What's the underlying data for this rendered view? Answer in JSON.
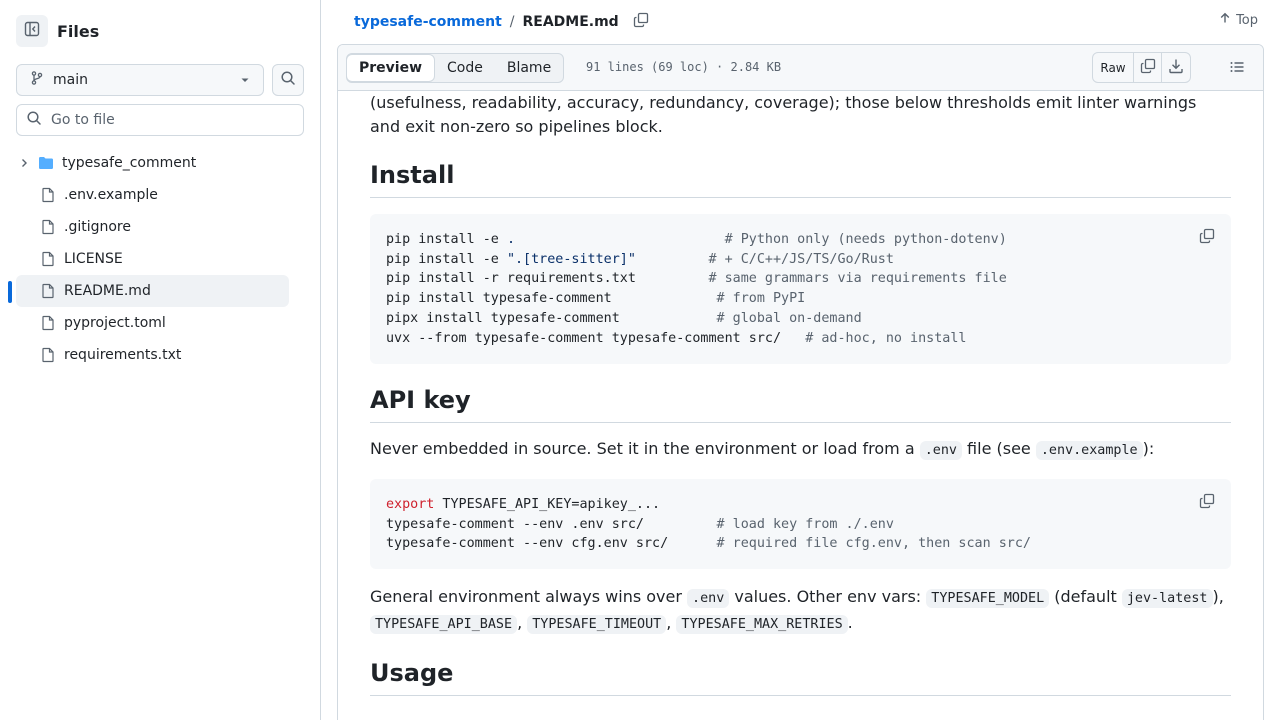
{
  "sidebar": {
    "title": "Files",
    "branch": "main",
    "goto_placeholder": "Go to file",
    "items": [
      {
        "label": "typesafe_comment",
        "type": "folder"
      },
      {
        "label": ".env.example",
        "type": "file"
      },
      {
        "label": ".gitignore",
        "type": "file"
      },
      {
        "label": "LICENSE",
        "type": "file"
      },
      {
        "label": "README.md",
        "type": "file",
        "active": true
      },
      {
        "label": "pyproject.toml",
        "type": "file"
      },
      {
        "label": "requirements.txt",
        "type": "file"
      }
    ]
  },
  "header": {
    "repo": "typesafe-comment",
    "separator": "/",
    "file": "README.md",
    "top_label": "Top"
  },
  "fileview": {
    "tabs": [
      "Preview",
      "Code",
      "Blame"
    ],
    "active_tab": "Preview",
    "meta": "91 lines (69 loc) · 2.84 KB",
    "raw_label": "Raw"
  },
  "readme": {
    "intro": "(usefulness, readability, accuracy, redundancy, coverage); those below thresholds emit linter warnings and exit non-zero so pipelines block.",
    "install_heading": "Install",
    "install_lines": [
      {
        "cmd": "pip install -e ",
        "arg": ".",
        "pad": "                          ",
        "comment": "# Python only (needs python-dotenv)"
      },
      {
        "cmd": "pip install -e ",
        "arg": "\".[tree-sitter]\"",
        "pad": "         ",
        "comment": "# + C/C++/JS/TS/Go/Rust"
      },
      {
        "cmd": "pip install -r requirements.txt",
        "arg": "",
        "pad": "         ",
        "comment": "# same grammars via requirements file"
      },
      {
        "cmd": "pip install typesafe-comment",
        "arg": "",
        "pad": "             ",
        "comment": "# from PyPI"
      },
      {
        "cmd": "pipx install typesafe-comment",
        "arg": "",
        "pad": "            ",
        "comment": "# global on-demand"
      },
      {
        "cmd": "uvx --from typesafe-comment typesafe-comment src/",
        "arg": "",
        "pad": "   ",
        "comment": "# ad-hoc, no install"
      }
    ],
    "apikey_heading": "API key",
    "apikey_text_1": "Never embedded in source. Set it in the environment or load from a ",
    "apikey_code_1": ".env",
    "apikey_text_2": " file (see ",
    "apikey_code_2": ".env.example",
    "apikey_text_3": "):",
    "env_lines": [
      {
        "kw": "export",
        "cmd": " TYPESAFE_API_KEY=apikey_...",
        "pad": "",
        "comment": ""
      },
      {
        "kw": "",
        "cmd": "typesafe-comment --env .env src/",
        "pad": "         ",
        "comment": "# load key from ./.env"
      },
      {
        "kw": "",
        "cmd": "typesafe-comment --env cfg.env src/",
        "pad": "      ",
        "comment": "# required file cfg.env, then scan src/"
      }
    ],
    "general_text_1": "General environment always wins over ",
    "general_code_1": ".env",
    "general_text_2": " values. Other env vars: ",
    "general_code_2": "TYPESAFE_MODEL",
    "general_text_3": " (default ",
    "general_code_3": "jev-latest",
    "general_text_4": "),",
    "general_code_4": "TYPESAFE_API_BASE",
    "general_sep_1": ", ",
    "general_code_5": "TYPESAFE_TIMEOUT",
    "general_sep_2": ", ",
    "general_code_6": "TYPESAFE_MAX_RETRIES",
    "general_text_5": ".",
    "usage_heading": "Usage"
  },
  "colors": {
    "link": "#0969da",
    "border": "#d1d9e0",
    "muted": "#59636e",
    "keyword": "#cf222e",
    "string": "#0a3069",
    "folder": "#54aeff"
  },
  "icons": [
    "sidebar-collapse-icon",
    "branch-icon",
    "chevron-down-icon",
    "search-icon",
    "chevron-right-icon",
    "folder-icon",
    "file-icon",
    "copy-icon",
    "arrow-up-icon",
    "download-icon",
    "list-icon"
  ]
}
